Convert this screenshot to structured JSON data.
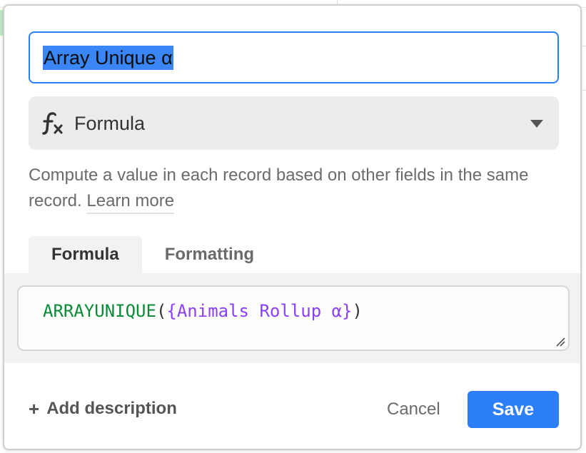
{
  "background": {
    "trailing_char": ","
  },
  "field_dialog": {
    "name_value": "Array Unique α",
    "field_type": {
      "icon": "formula-fx-icon",
      "label": "Formula"
    },
    "description_text": "Compute a value in each record based on other fields in the same record.",
    "learn_more_label": "Learn more",
    "tabs": [
      {
        "label": "Formula",
        "active": true
      },
      {
        "label": "Formatting",
        "active": false
      }
    ],
    "formula": {
      "function_name": "ARRAYUNIQUE",
      "open_paren": "(",
      "field_ref": "{Animals Rollup α}",
      "close_paren": ")"
    },
    "add_description_label": "Add description",
    "cancel_label": "Cancel",
    "save_label": "Save"
  },
  "colors": {
    "accent": "#2d7ff9",
    "selection": "#3a86f6",
    "function_color": "#0b8a3a",
    "field_ref_color": "#8a3ffc",
    "paren_color": "#333333"
  }
}
